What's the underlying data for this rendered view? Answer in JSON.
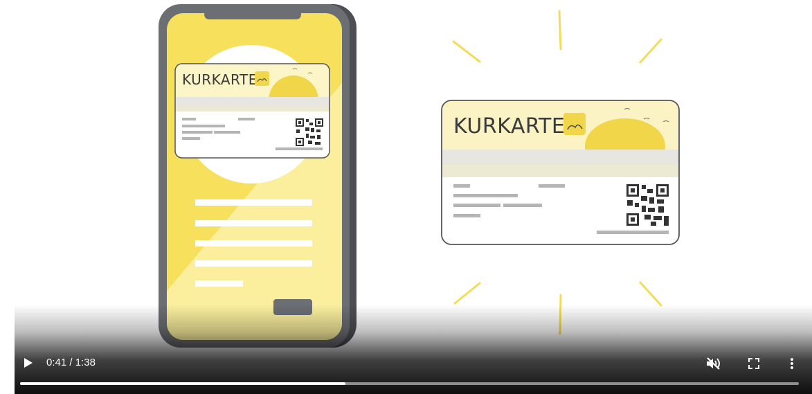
{
  "video": {
    "current_time": "0:41",
    "duration": "1:38",
    "time_separator": " / ",
    "progress_fraction": 0.418,
    "muted": true
  },
  "scene": {
    "phone_card_title": "KURKARTE",
    "standalone_card_title": "KURKARTE"
  },
  "colors": {
    "yellow": "#f6e05c",
    "yellow_light": "#fbef9e",
    "sun": "#f1d64a",
    "phone_frame": "#6b6e73",
    "ray": "#f2dc5a",
    "card_stroke": "#555555"
  },
  "icons": {
    "play": "play-icon",
    "mute": "volume-muted-icon",
    "fullscreen": "fullscreen-icon",
    "more": "more-vertical-icon",
    "card_logo": "beach-logo-icon"
  }
}
